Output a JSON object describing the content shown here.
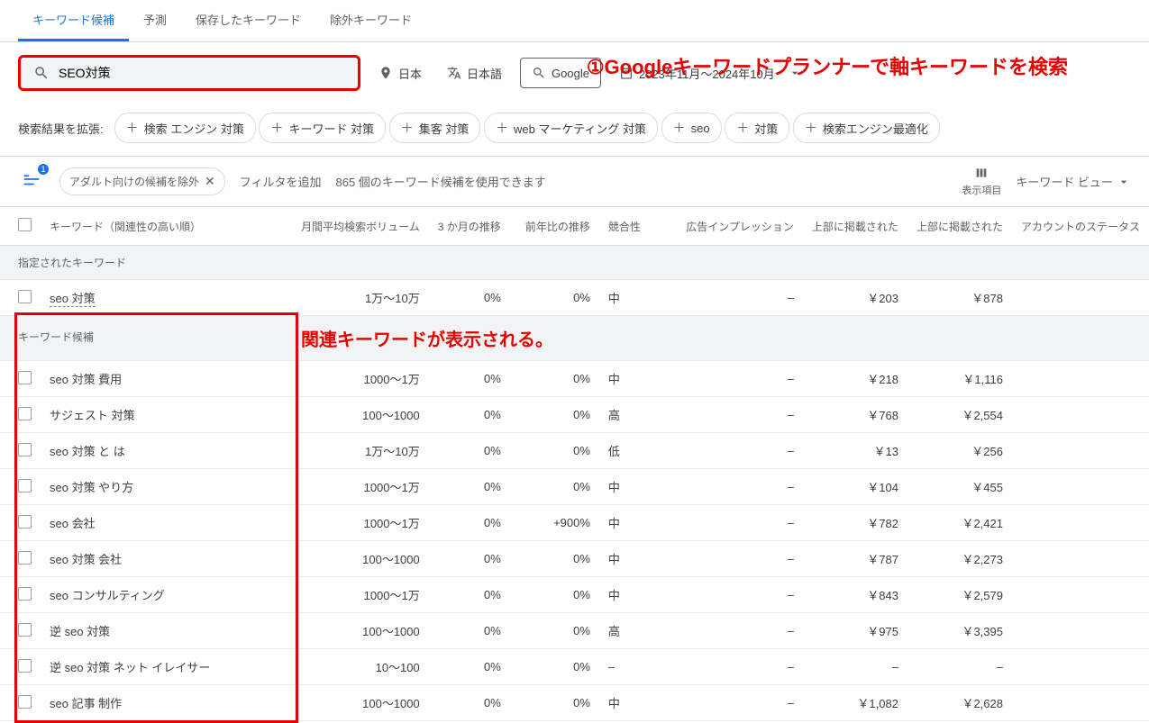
{
  "tabs": [
    {
      "label": "キーワード候補",
      "active": true
    },
    {
      "label": "予測",
      "active": false
    },
    {
      "label": "保存したキーワード",
      "active": false
    },
    {
      "label": "除外キーワード",
      "active": false
    }
  ],
  "annotations": {
    "a1": "①Googleキーワードプランナーで軸キーワードを検索",
    "a2": "関連キーワードが表示される。"
  },
  "search": {
    "value": "SEO対策"
  },
  "settings": {
    "location": "日本",
    "language": "日本語",
    "network": "Google",
    "date_range": "2023年11月～2024年10月"
  },
  "broaden": {
    "label": "検索結果を拡張:",
    "chips": [
      "検索 エンジン 対策",
      "キーワード 対策",
      "集客 対策",
      "web マーケティング 対策",
      "seo",
      "対策",
      "検索エンジン最適化"
    ]
  },
  "toolbar": {
    "refine_badge": "1",
    "exclude_chip": "アダルト向けの候補を除外",
    "add_filter": "フィルタを追加",
    "count_text": "865 個のキーワード候補を使用できます",
    "columns_label": "表示項目",
    "view_label": "キーワード ビュー"
  },
  "columns": {
    "keyword": "キーワード（関連性の高い順）",
    "volume": "月間平均検索ボリューム",
    "three_month": "3 か月の推移",
    "yoy": "前年比の推移",
    "competition": "競合性",
    "impr": "広告インプレッション",
    "bid_low": "上部に掲載された",
    "bid_high": "上部に掲載された",
    "status": "アカウントのステータス"
  },
  "sections": {
    "provided": "指定されたキーワード",
    "ideas": "キーワード候補"
  },
  "provided_row": {
    "keyword": "seo 対策",
    "volume": "1万～10万",
    "three_month": "0%",
    "yoy": "0%",
    "competition": "中",
    "impr": "–",
    "bid_low": "￥203",
    "bid_high": "￥878"
  },
  "rows": [
    {
      "keyword": "seo 対策 費用",
      "volume": "1000～1万",
      "three_month": "0%",
      "yoy": "0%",
      "competition": "中",
      "impr": "–",
      "bid_low": "￥218",
      "bid_high": "￥1,116"
    },
    {
      "keyword": "サジェスト 対策",
      "volume": "100～1000",
      "three_month": "0%",
      "yoy": "0%",
      "competition": "高",
      "impr": "–",
      "bid_low": "￥768",
      "bid_high": "￥2,554"
    },
    {
      "keyword": "seo 対策 と は",
      "volume": "1万～10万",
      "three_month": "0%",
      "yoy": "0%",
      "competition": "低",
      "impr": "–",
      "bid_low": "￥13",
      "bid_high": "￥256"
    },
    {
      "keyword": "seo 対策 やり方",
      "volume": "1000～1万",
      "three_month": "0%",
      "yoy": "0%",
      "competition": "中",
      "impr": "–",
      "bid_low": "￥104",
      "bid_high": "￥455"
    },
    {
      "keyword": "seo 会社",
      "volume": "1000～1万",
      "three_month": "0%",
      "yoy": "+900%",
      "competition": "中",
      "impr": "–",
      "bid_low": "￥782",
      "bid_high": "￥2,421"
    },
    {
      "keyword": "seo 対策 会社",
      "volume": "100～1000",
      "three_month": "0%",
      "yoy": "0%",
      "competition": "中",
      "impr": "–",
      "bid_low": "￥787",
      "bid_high": "￥2,273"
    },
    {
      "keyword": "seo コンサルティング",
      "volume": "1000～1万",
      "three_month": "0%",
      "yoy": "0%",
      "competition": "中",
      "impr": "–",
      "bid_low": "￥843",
      "bid_high": "￥2,579"
    },
    {
      "keyword": "逆 seo 対策",
      "volume": "100～1000",
      "three_month": "0%",
      "yoy": "0%",
      "competition": "高",
      "impr": "–",
      "bid_low": "￥975",
      "bid_high": "￥3,395"
    },
    {
      "keyword": "逆 seo 対策 ネット イレイサー",
      "volume": "10～100",
      "three_month": "0%",
      "yoy": "0%",
      "competition": "–",
      "impr": "–",
      "bid_low": "–",
      "bid_high": "–"
    },
    {
      "keyword": "seo 記事 制作",
      "volume": "100～1000",
      "three_month": "0%",
      "yoy": "0%",
      "competition": "中",
      "impr": "–",
      "bid_low": "￥1,082",
      "bid_high": "￥2,628"
    }
  ]
}
